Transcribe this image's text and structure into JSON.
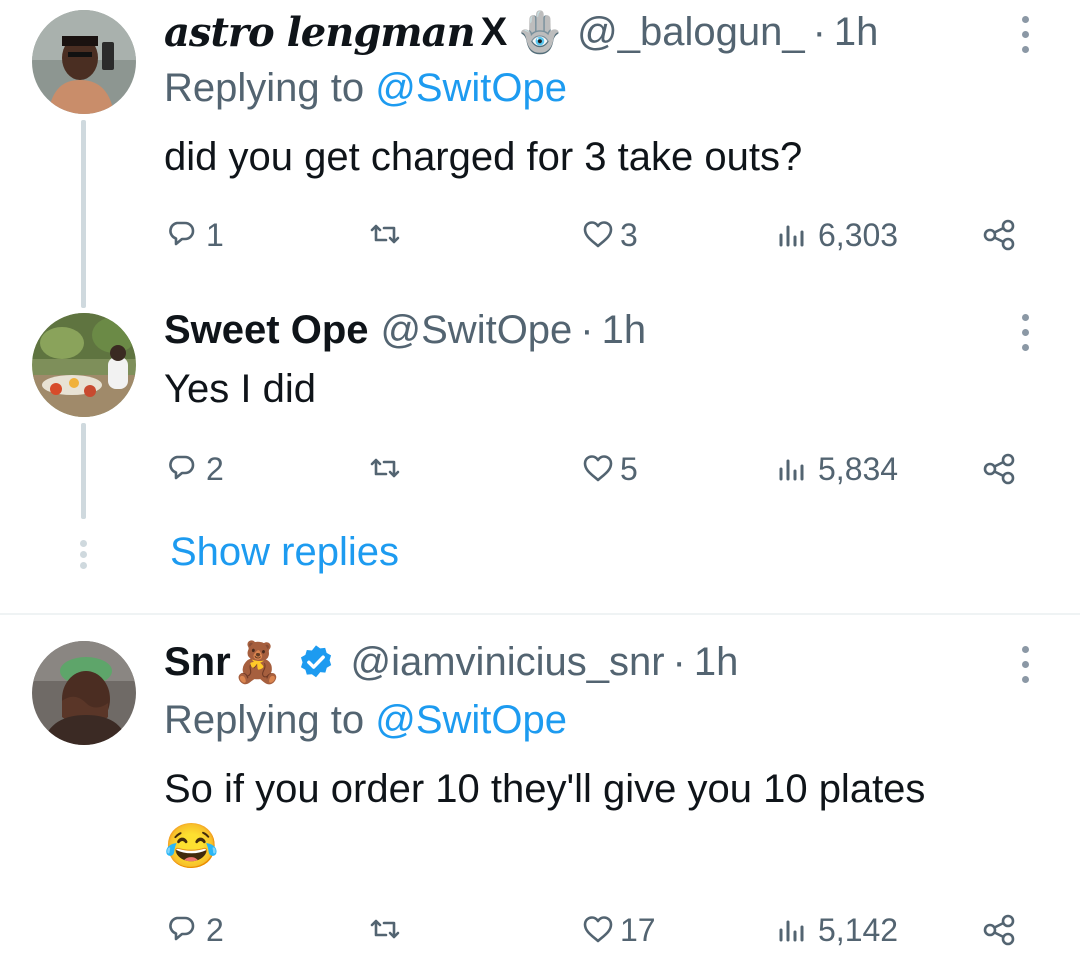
{
  "tweets": [
    {
      "name": "astro lengman",
      "name_suffix": "X",
      "emoji": "🪬",
      "handle": "@_balogun_",
      "time": "1h",
      "replying_label": "Replying to",
      "replying_handle": "@SwitOpe",
      "text": "did you get charged for 3 take outs?",
      "replies": "1",
      "retweets": "",
      "likes": "3",
      "views": "6,303"
    },
    {
      "name": "Sweet Ope",
      "handle": "@SwitOpe",
      "time": "1h",
      "text": "Yes I did",
      "replies": "2",
      "retweets": "",
      "likes": "5",
      "views": "5,834"
    },
    {
      "name": "Snr",
      "emoji": "🧸",
      "handle": "@iamvinicius_snr",
      "time": "1h",
      "replying_label": "Replying to",
      "replying_handle": "@SwitOpe",
      "text": "So if you order 10 they'll give you 10 plates",
      "text_emoji": "😂",
      "replies": "2",
      "retweets": "",
      "likes": "17",
      "views": "5,142"
    }
  ],
  "show_replies": "Show replies",
  "separator": "·",
  "colors": {
    "accent": "#1d9bf0",
    "muted": "#536471",
    "line": "#cfd9de",
    "text": "#0f1419"
  },
  "icons": [
    "reply-icon",
    "retweet-icon",
    "like-icon",
    "views-icon",
    "share-icon",
    "more-icon",
    "verified-badge-icon"
  ]
}
